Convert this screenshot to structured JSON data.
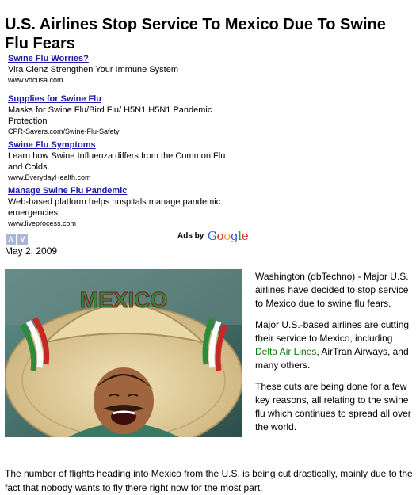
{
  "article": {
    "title": "U.S. Airlines Stop Service To Mexico Due To Swine Flu Fears",
    "date": "May 2, 2009"
  },
  "ads": [
    {
      "title": "Swine Flu Worries?",
      "desc": "Vira Clenz Strengthen Your Immune System",
      "url": "www.vdcusa.com"
    },
    {
      "title": "Supplies for Swine Flu",
      "desc": "Masks for Swine Flu/Bird Flu/ H5N1 H5N1 Pandemic Protection",
      "url": "CPR-Savers.com/Swine-Flu-Safety"
    },
    {
      "title": "Swine Flu Symptoms",
      "desc": "Learn how Swine Influenza differs from the Common Flu and Colds.",
      "url": "www.EverydayHealth.com"
    },
    {
      "title": "Manage Swine Flu Pandemic",
      "desc": "Web-based platform helps hospitals manage pandemic emergencies.",
      "url": "www.liveprocess.com"
    }
  ],
  "ad_nav": {
    "prev": "Λ",
    "next": "V"
  },
  "ads_by": {
    "label": "Ads by",
    "brand": "Google"
  },
  "photo": {
    "hat_text": "MEXICO"
  },
  "body": {
    "p1": "Washington (dbTechno) - Major U.S. airlines have decided to stop service to Mexico due to swine flu fears.",
    "p2_before": "Major U.S.-based airlines are cutting their service to Mexico, including ",
    "p2_link": "Delta Air Lines",
    "p2_after": ", AirTran Airways, and many others.",
    "p3": "These cuts are being done for a few key reasons, all relating to the swine flu which continues to spread all over the world.",
    "p4": "The number of flights heading into Mexico from the U.S. is being cut drastically, mainly due to the fact that nobody wants to fly there right now for the most part."
  },
  "colors": {
    "ad_link": "#1a1aa6",
    "article_link": "#0a7d0a",
    "nav_button": "#aab7d6"
  }
}
